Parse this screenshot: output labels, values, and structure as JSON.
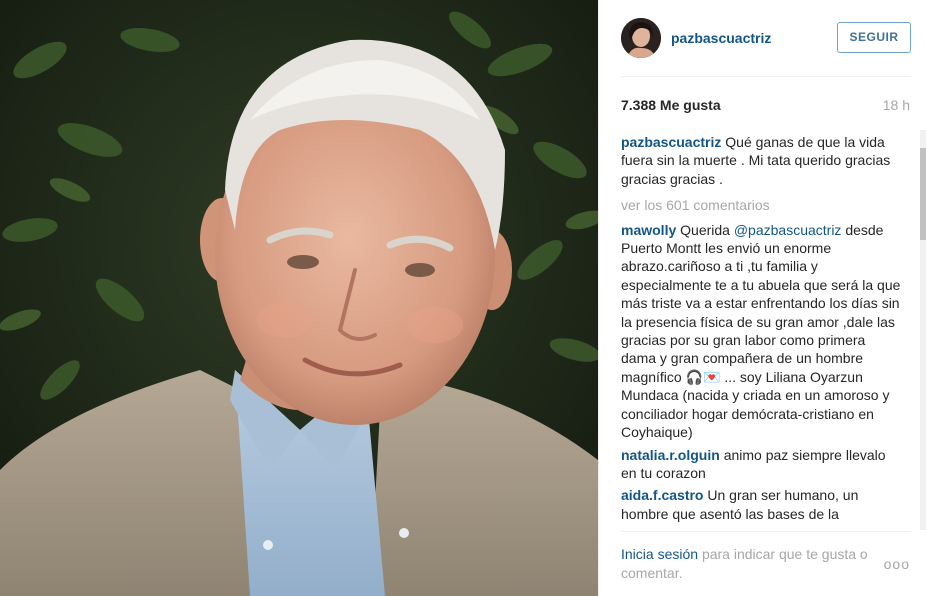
{
  "post": {
    "username": "pazbascuactriz",
    "follow_label": "SEGUIR",
    "likes": "7.388 Me gusta",
    "time": "18 h"
  },
  "caption": {
    "user": "pazbascuactriz",
    "text": "Qué ganas de que la vida fuera sin la muerte . Mi tata querido gracias gracias gracias ."
  },
  "view_all": "ver los 601 comentarios",
  "comments": [
    {
      "user": "mawolly",
      "pre": "Querida",
      "mention": "@pazbascuactriz",
      "text": "desde Puerto Montt les envió un enorme abrazo.cariñoso a ti ,tu familia y especialmente te a tu abuela que será la que más triste va a estar enfrentando los días sin la presencia física de su gran amor ,dale las gracias por su gran labor como primera dama y gran compañera de un hombre magnífico 🎧💌 ... soy Liliana Oyarzun Mundaca (nacida y criada en un amoroso y conciliador hogar demócrata-cristiano en Coyhaique)"
    },
    {
      "user": "natalia.r.olguin",
      "text": "animo paz siempre llevalo en tu corazon"
    },
    {
      "user": "aida.f.castro",
      "text": "Un gran ser humano, un hombre que asentó las bases de la"
    }
  ],
  "footer": {
    "login_link": "Inicia sesión",
    "rest": "para indicar que te gusta o comentar.",
    "more": "ooo"
  },
  "colors": {
    "link": "#125688",
    "muted": "#a5a7aa",
    "follow_border": "#70a3c7"
  }
}
